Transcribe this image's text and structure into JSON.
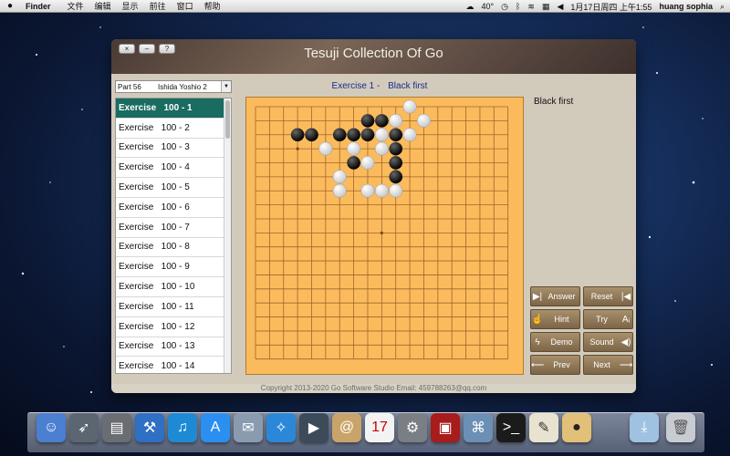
{
  "menubar": {
    "apple": "",
    "app": "Finder",
    "items": [
      "文件",
      "编辑",
      "显示",
      "前往",
      "窗口",
      "帮助"
    ],
    "status": {
      "weather": "40°",
      "datetime": "1月17日周四 上午1:55",
      "user": "huang sophia"
    }
  },
  "window": {
    "title": "Tesuji Collection Of Go",
    "buttons": {
      "close": "×",
      "minimize": "–",
      "help": "?"
    }
  },
  "selector": {
    "part": "Part 56",
    "author": "Ishida Yoshio 2"
  },
  "exercise_header": {
    "number": "Exercise 1  -",
    "to_move": "Black first"
  },
  "status_label": "Black first",
  "exercises": [
    "Exercise   100 - 1",
    "Exercise   100 - 2",
    "Exercise   100 - 3",
    "Exercise   100 - 4",
    "Exercise   100 - 5",
    "Exercise   100 - 6",
    "Exercise   100 - 7",
    "Exercise   100 - 8",
    "Exercise   100 - 9",
    "Exercise   100 - 10",
    "Exercise   100 - 11",
    "Exercise   100 - 12",
    "Exercise   100 - 13",
    "Exercise   100 - 14"
  ],
  "selected_exercise": 0,
  "controls": {
    "answer": "Answer",
    "reset": "Reset",
    "hint": "Hint",
    "try": "Try",
    "demo": "Demo",
    "sound": "Sound",
    "prev": "Prev",
    "next": "Next"
  },
  "footer": "Copyright 2013-2020 Go Software Studio    Email: 459788263@qq.com",
  "board": {
    "size": 19,
    "hoshi": [
      [
        3,
        3
      ],
      [
        9,
        9
      ]
    ],
    "black": [
      [
        8,
        1
      ],
      [
        9,
        1
      ],
      [
        3,
        2
      ],
      [
        4,
        2
      ],
      [
        6,
        2
      ],
      [
        7,
        2
      ],
      [
        8,
        2
      ],
      [
        10,
        2
      ],
      [
        10,
        3
      ],
      [
        7,
        4
      ],
      [
        10,
        4
      ],
      [
        10,
        5
      ]
    ],
    "white": [
      [
        11,
        0
      ],
      [
        10,
        1
      ],
      [
        12,
        1
      ],
      [
        9,
        2
      ],
      [
        11,
        2
      ],
      [
        5,
        3
      ],
      [
        7,
        3
      ],
      [
        9,
        3
      ],
      [
        8,
        4
      ],
      [
        6,
        5
      ],
      [
        6,
        6
      ],
      [
        8,
        6
      ],
      [
        9,
        6
      ],
      [
        10,
        6
      ]
    ]
  }
}
